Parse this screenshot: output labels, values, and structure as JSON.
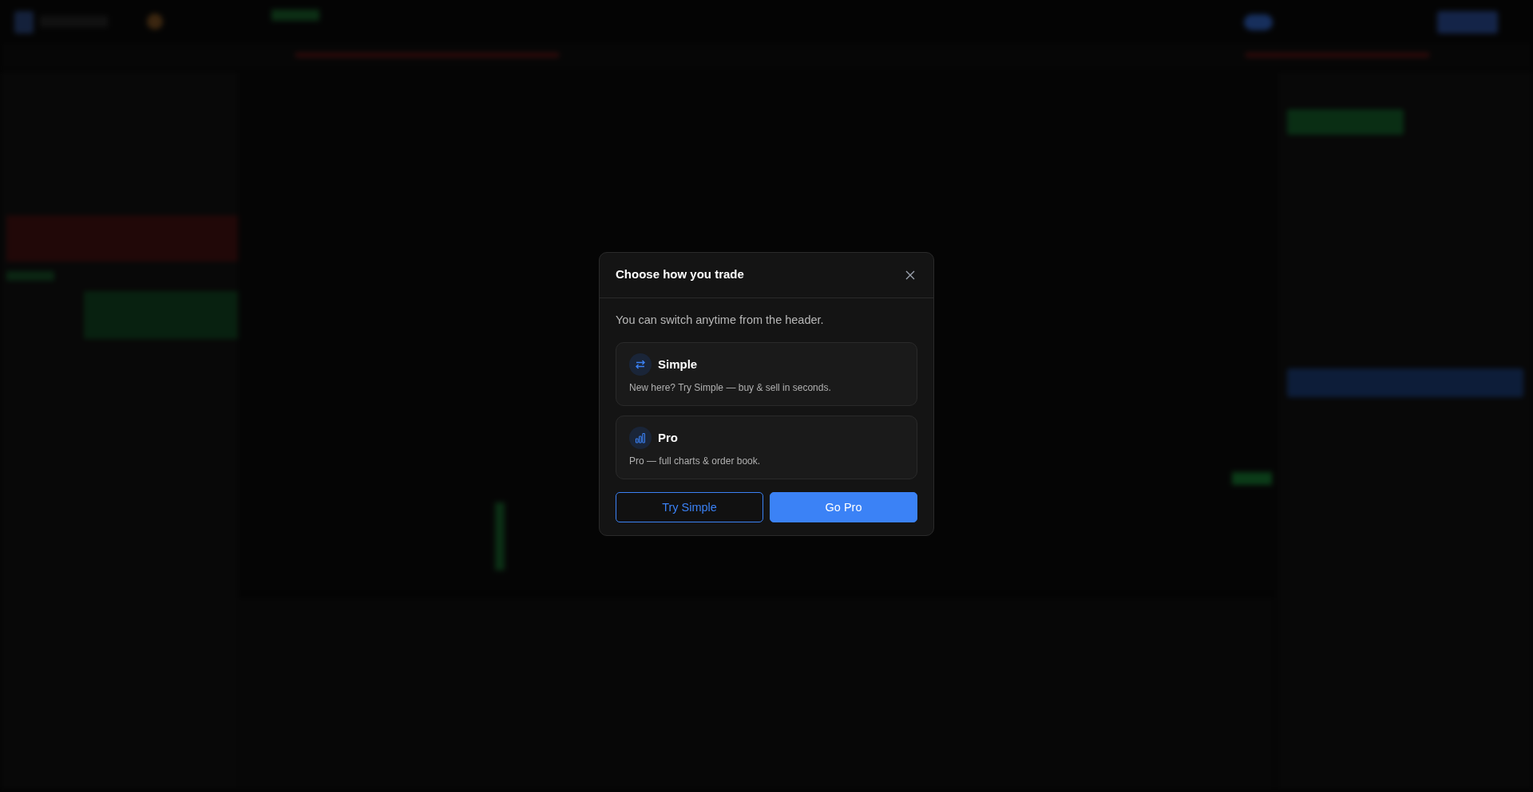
{
  "dialog": {
    "title": "Choose how you trade",
    "subtitle": "You can switch anytime from the header.",
    "options": [
      {
        "kind": "swap",
        "title": "Simple",
        "description": "New here? Try Simple — buy & sell in seconds."
      },
      {
        "kind": "bars",
        "title": "Pro",
        "description": "Pro — full charts & order book."
      }
    ],
    "buttons": [
      {
        "kind": "outline",
        "label": "Try Simple"
      },
      {
        "kind": "primary",
        "label": "Go Pro"
      }
    ]
  }
}
